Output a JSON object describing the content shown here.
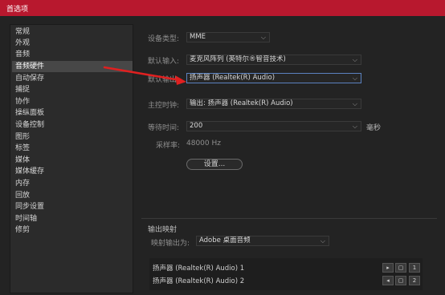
{
  "window": {
    "title": "首选项"
  },
  "sidebar": {
    "items": [
      {
        "label": "常规",
        "selected": false
      },
      {
        "label": "外观",
        "selected": false
      },
      {
        "label": "音频",
        "selected": false
      },
      {
        "label": "音频硬件",
        "selected": true
      },
      {
        "label": "自动保存",
        "selected": false
      },
      {
        "label": "捕捉",
        "selected": false
      },
      {
        "label": "协作",
        "selected": false
      },
      {
        "label": "操纵面板",
        "selected": false
      },
      {
        "label": "设备控制",
        "selected": false
      },
      {
        "label": "图形",
        "selected": false
      },
      {
        "label": "标签",
        "selected": false
      },
      {
        "label": "媒体",
        "selected": false
      },
      {
        "label": "媒体缓存",
        "selected": false
      },
      {
        "label": "内存",
        "selected": false
      },
      {
        "label": "回放",
        "selected": false
      },
      {
        "label": "同步设置",
        "selected": false
      },
      {
        "label": "时间轴",
        "selected": false
      },
      {
        "label": "修剪",
        "selected": false
      }
    ]
  },
  "settings": {
    "device_type": {
      "label": "设备类型:",
      "value": "MME"
    },
    "default_input": {
      "label": "默认输入:",
      "value": "麦克风阵列 (英特尔®智音技术)"
    },
    "default_output": {
      "label": "默认输出:",
      "value": "扬声器 (Realtek(R) Audio)"
    },
    "master_clock": {
      "label": "主控时钟:",
      "value": "输出: 扬声器 (Realtek(R) Audio)"
    },
    "latency": {
      "label": "等待时间:",
      "value": "200",
      "unit": "毫秒"
    },
    "sample_rate": {
      "label": "采样率:",
      "value": "48000 Hz"
    },
    "settings_button": "设置..."
  },
  "output_mapping": {
    "section_title": "输出映射",
    "map_output_label": "映射输出为:",
    "map_output_value": "Adobe 桌面音频",
    "channels": [
      {
        "label": "扬声器 (Realtek(R) Audio) 1",
        "index": "1"
      },
      {
        "label": "扬声器 (Realtek(R) Audio) 2",
        "index": "2"
      }
    ]
  },
  "icons": {
    "chevron": "chevron-down-icon",
    "arrow_color": "#e02020"
  }
}
